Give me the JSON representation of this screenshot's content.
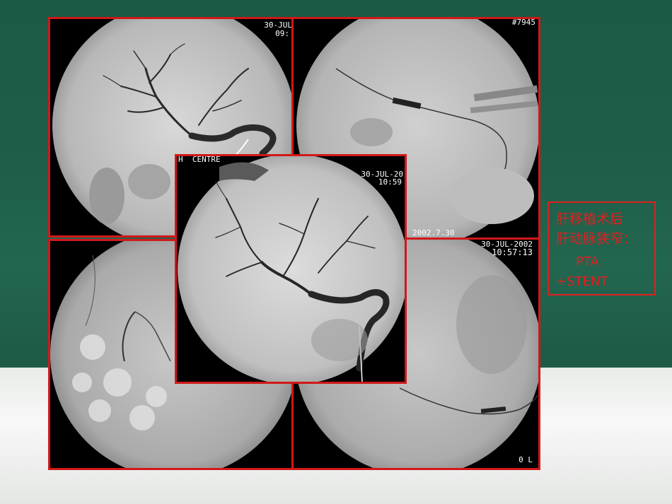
{
  "caption": {
    "line1": "肝移植术后",
    "line2": "肝动脉狭窄：",
    "line3": "PTA",
    "line4": "+STENT"
  },
  "panels": {
    "top_left": {
      "stamp_date": "30-JUL",
      "stamp_time": "09:"
    },
    "top_right": {
      "stamp_corner": "#7945",
      "stamp_date_bottom": "2002.7.30"
    },
    "center": {
      "stamp_header": "H  CENTRE",
      "stamp_date": "30-JUL-20",
      "stamp_time": "10:59"
    },
    "bottom_right": {
      "stamp_date": "30-JUL-2002",
      "stamp_time": "10:57:13",
      "stamp_corner": "0 L"
    }
  },
  "colors": {
    "frame": "#d21818",
    "caption": "#e02020",
    "board": "#1f5f49"
  }
}
